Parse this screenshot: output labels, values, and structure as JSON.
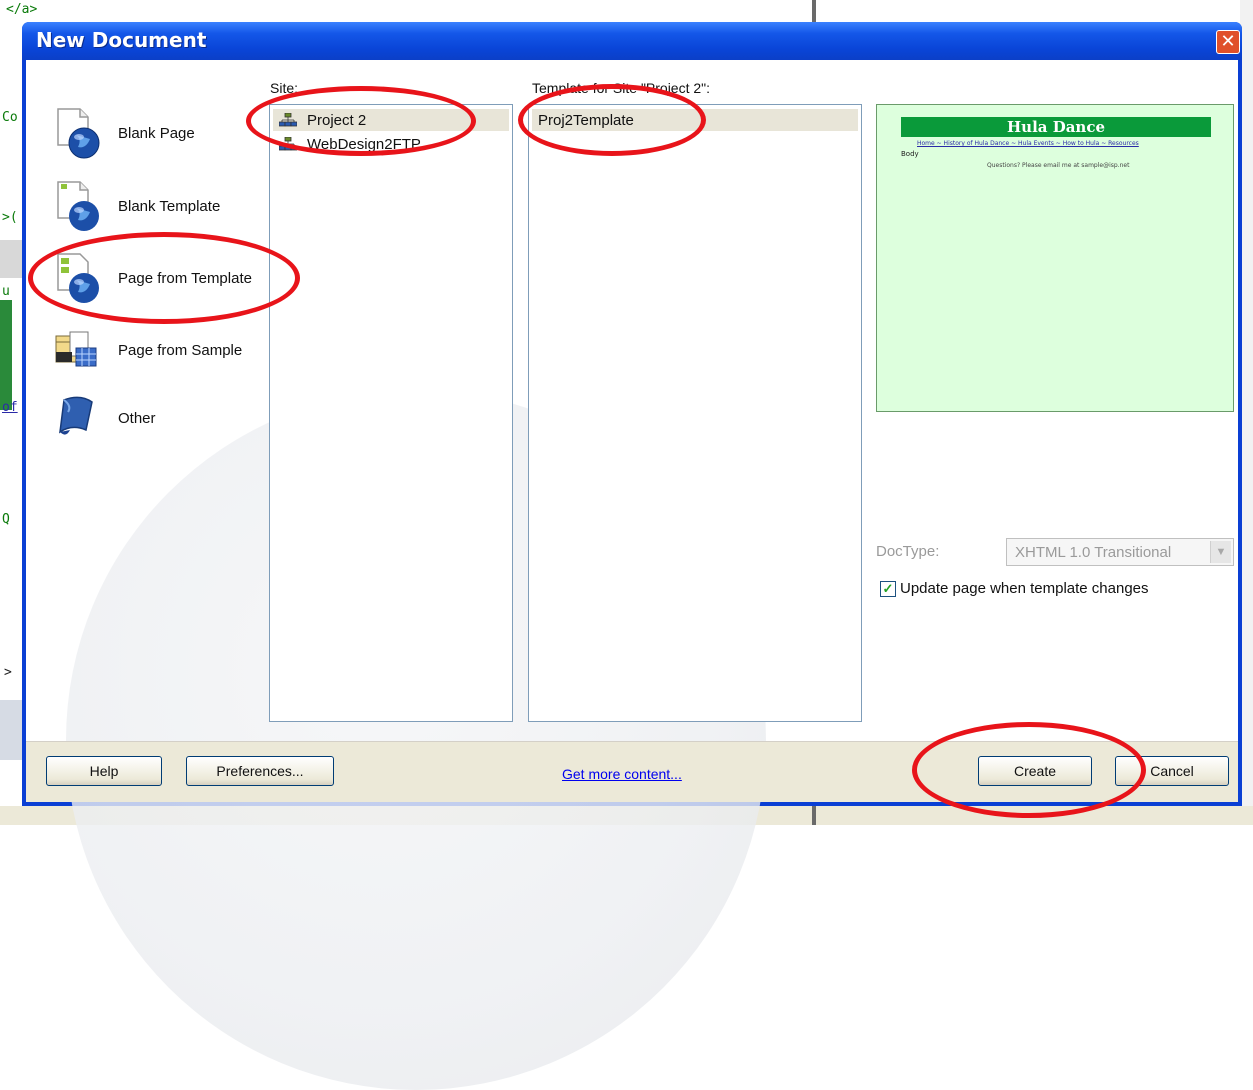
{
  "background": {
    "code_top": "</a>",
    "fragments": [
      "Co",
      ">(",
      "u",
      "of",
      "Q",
      ">"
    ]
  },
  "dialog": {
    "title": "New Document",
    "close_glyph": "✕"
  },
  "categories": [
    {
      "label": "Blank Page",
      "icon": "blank-page-icon"
    },
    {
      "label": "Blank Template",
      "icon": "blank-template-icon"
    },
    {
      "label": "Page from Template",
      "icon": "page-from-template-icon"
    },
    {
      "label": "Page from Sample",
      "icon": "page-from-sample-icon"
    },
    {
      "label": "Other",
      "icon": "other-icon"
    }
  ],
  "site": {
    "label": "Site:",
    "items": [
      {
        "label": "Project 2",
        "icon": "site-icon"
      },
      {
        "label": "WebDesign2FTP",
        "icon": "site-icon"
      }
    ]
  },
  "template": {
    "label": "Template for Site \"Project 2\":",
    "items": [
      {
        "label": "Proj2Template"
      }
    ]
  },
  "preview": {
    "banner": "Hula Dance",
    "nav": "Home ~ History of Hula Dance ~ Hula Events ~ How to Hula ~ Resources",
    "body": "Body",
    "question": "Questions? Please email me at sample@isp.net"
  },
  "doctype": {
    "label": "DocType:",
    "value": "XHTML 1.0 Transitional"
  },
  "update_checkbox": {
    "label": "Update page when template changes",
    "checked": true
  },
  "footer": {
    "help": "Help",
    "preferences": "Preferences...",
    "get_more": "Get more content...",
    "create": "Create",
    "cancel": "Cancel"
  },
  "colors": {
    "annotation": "#e8141a",
    "title_blue": "#0a45d8",
    "preview_bg": "#ddffdd"
  }
}
